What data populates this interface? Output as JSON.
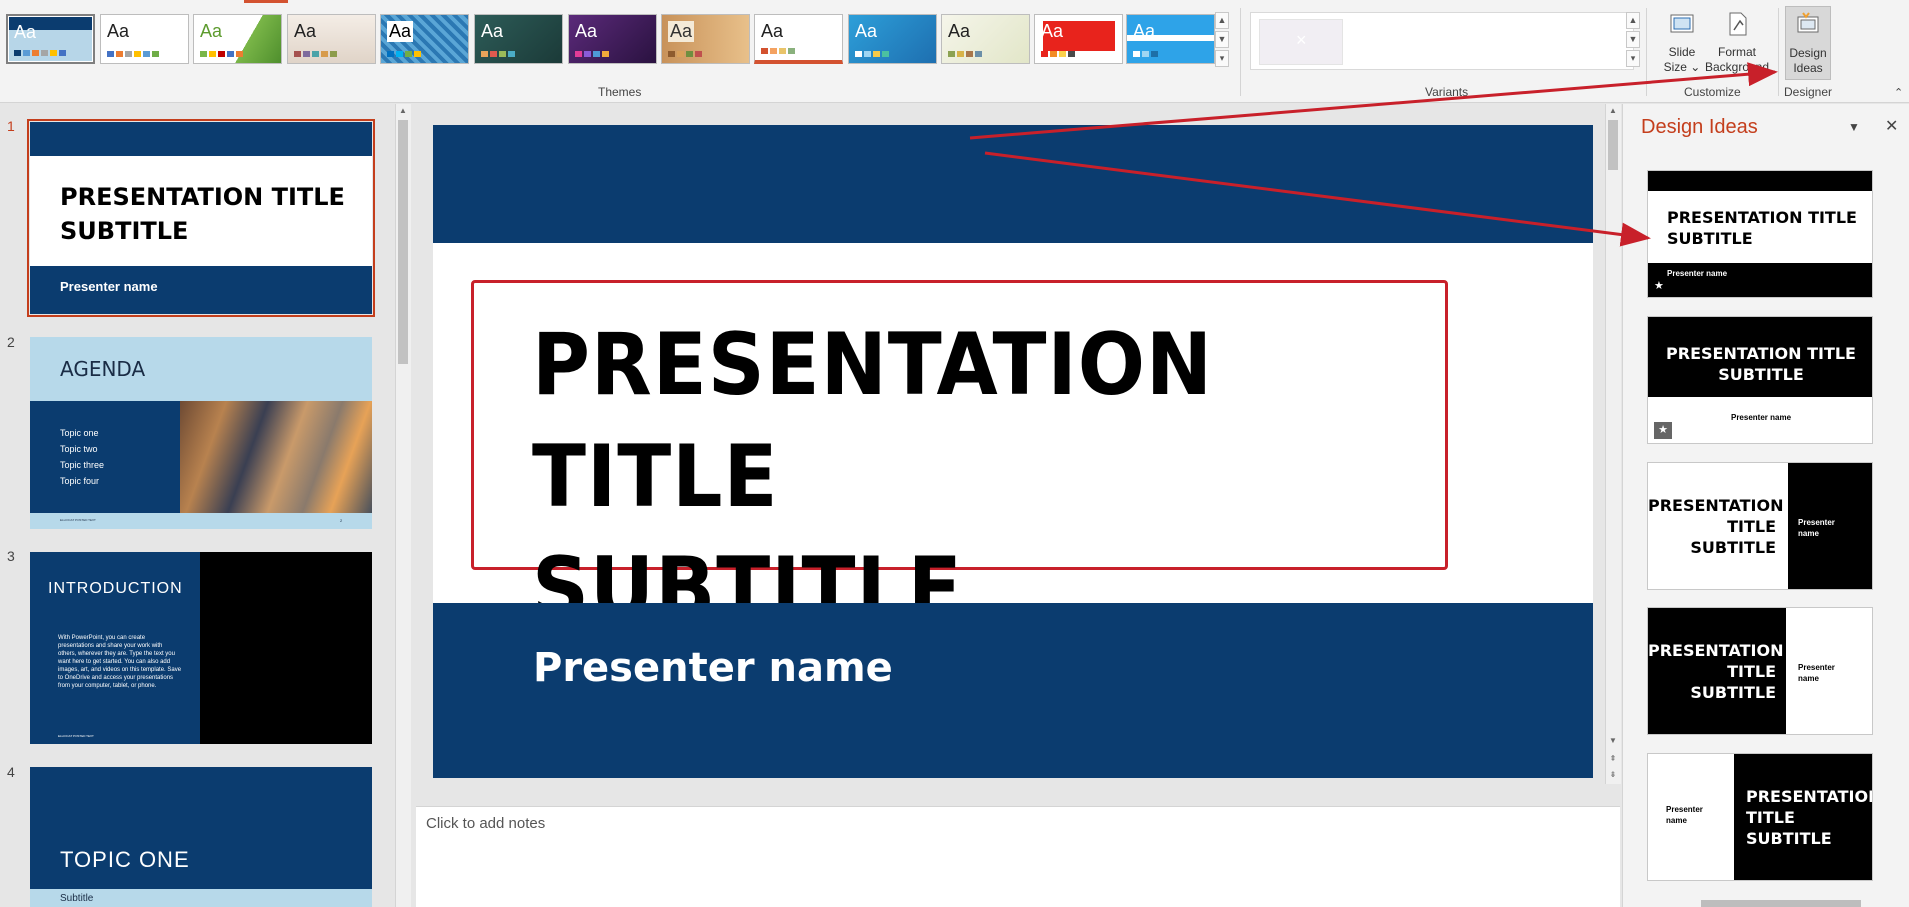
{
  "ribbon": {
    "themes_label": "Themes",
    "variants_label": "Variants",
    "customize_label": "Customize",
    "designer_label": "Designer",
    "theme_glyph": "Aa",
    "slide_size_label": "Slide\nSize",
    "slide_size_line1": "Slide",
    "slide_size_line2": "Size ⌄",
    "format_bg_line1": "Format",
    "format_bg_line2": "Background",
    "design_ideas_line1": "Design",
    "design_ideas_line2": "Ideas",
    "icons": [
      "slide-size-icon",
      "format-background-icon",
      "design-ideas-icon"
    ]
  },
  "slides": [
    {
      "number": "1",
      "title_line1": "PRESENTATION TITLE",
      "title_line2": "SUBTITLE",
      "presenter": "Presenter name"
    },
    {
      "number": "2",
      "title": "AGENDA",
      "topics": [
        "Topic one",
        "Topic two",
        "Topic three",
        "Topic four"
      ],
      "footer_left": "ELLIOCAT POSTED TEXT",
      "footer_right": "2"
    },
    {
      "number": "3",
      "title": "INTRODUCTION",
      "body": "With PowerPoint, you can create presentations and share your work with others, wherever they are. Type the text you want here to get started. You can also add images, art, and videos on this template. Save to OneDrive and access your presentations from your computer, tablet, or phone.",
      "footer": "ELLIOCAT POSTED TEXT"
    },
    {
      "number": "4",
      "title": "TOPIC ONE",
      "subtitle": "Subtitle"
    }
  ],
  "main_slide": {
    "title_line1": "PRESENTATION TITLE",
    "title_line2": "SUBTITLE",
    "presenter": "Presenter name"
  },
  "notes": {
    "placeholder": "Click to add notes"
  },
  "design_ideas": {
    "title": "Design Ideas",
    "ideas": [
      {
        "title1": "PRESENTATION TITLE",
        "title2": "SUBTITLE",
        "presenter": "Presenter name"
      },
      {
        "title1": "PRESENTATION TITLE",
        "title2": "SUBTITLE",
        "presenter": "Presenter name"
      },
      {
        "title1": "PRESENTATION",
        "title2": "TITLE",
        "title3": "SUBTITLE",
        "presenter1": "Presenter",
        "presenter2": "name"
      },
      {
        "title1": "PRESENTATION",
        "title2": "TITLE",
        "title3": "SUBTITLE",
        "presenter1": "Presenter",
        "presenter2": "name"
      },
      {
        "title1": "PRESENTATION",
        "title2": "TITLE",
        "title3": "SUBTITLE",
        "presenter1": "Presenter",
        "presenter2": "name"
      }
    ]
  },
  "colors": {
    "accent": "#c43e1c",
    "slide_blue": "#0b3c6f",
    "annotation_red": "#c8202a"
  }
}
